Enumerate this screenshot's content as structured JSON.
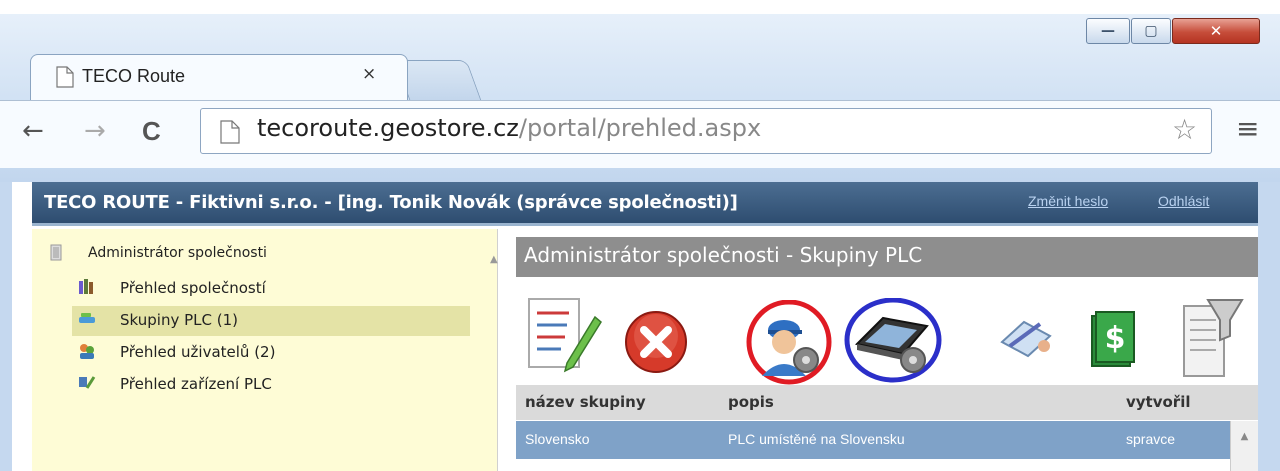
{
  "browser": {
    "tab_title": "TECO Route",
    "tab_close": "×",
    "url_host": "tecoroute.geostore.cz",
    "url_path": "/portal/prehled.aspx",
    "back_icon": "←",
    "forward_icon": "→",
    "reload_icon": "C",
    "star_icon": "☆",
    "menu_icon": "≡",
    "window_buttons": {
      "minimize": "—",
      "maximize": "▢",
      "close": "✕"
    }
  },
  "app": {
    "title": "TECO ROUTE - Fiktivni s.r.o. - [ing. Tonik Novák (správce společnosti)]",
    "change_password": "Změnit heslo",
    "logout": "Odhlásit"
  },
  "sidebar": {
    "root": "Administrátor společnosti",
    "items": [
      {
        "label": "Přehled společností",
        "icon": "books-icon"
      },
      {
        "label": "Skupiny PLC (1)",
        "icon": "group-icon",
        "selected": true
      },
      {
        "label": "Přehled uživatelů (2)",
        "icon": "users-icon"
      },
      {
        "label": "Přehled zařízení PLC",
        "icon": "devices-icon"
      }
    ]
  },
  "panel": {
    "title": "Administrátor společnosti - Skupiny PLC",
    "toolbar": [
      "edit-icon",
      "delete-icon",
      "user-settings-icon",
      "device-settings-icon",
      "sign-icon",
      "money-icon",
      "filter-icon"
    ]
  },
  "table": {
    "headers": [
      "název skupiny",
      "popis",
      "vytvořil"
    ],
    "rows": [
      [
        "Slovensko",
        "PLC umístěné na Slovensku",
        "spravce"
      ]
    ]
  },
  "colors": {
    "appbar": "#2e4d70",
    "sidebar_bg": "#fefcd6",
    "selected_row": "#7fa2c8",
    "highlight_red": "#e01b24",
    "highlight_blue": "#2b2fc9"
  }
}
